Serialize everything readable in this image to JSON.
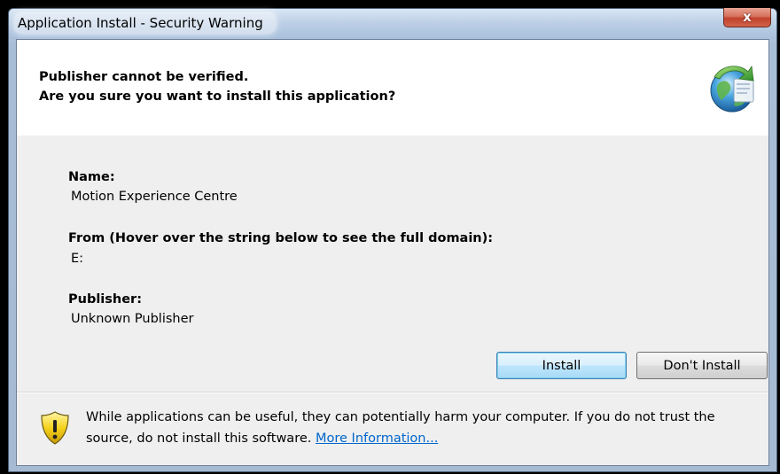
{
  "window": {
    "title": "Application Install - Security Warning",
    "close_glyph": "x"
  },
  "header": {
    "line1": "Publisher cannot be verified.",
    "line2": "Are you sure you want to install this application?",
    "icon": "globe-install-icon"
  },
  "details": {
    "name_label": "Name:",
    "name_value": "Motion Experience Centre",
    "from_label": "From (Hover over the string below to see the full domain):",
    "from_value": "E:",
    "publisher_label": "Publisher:",
    "publisher_value": "Unknown Publisher"
  },
  "buttons": {
    "install": "Install",
    "dont_install": "Don't Install"
  },
  "footer": {
    "icon": "warning-shield-icon",
    "warning_text": "While applications can be useful, they can potentially harm your computer. If you do not trust the source, do not install this software.",
    "more_info_link": "More Information..."
  },
  "colors": {
    "link": "#0066cc",
    "default_button_border": "#3c7fb1",
    "close_button": "#c0422b"
  }
}
